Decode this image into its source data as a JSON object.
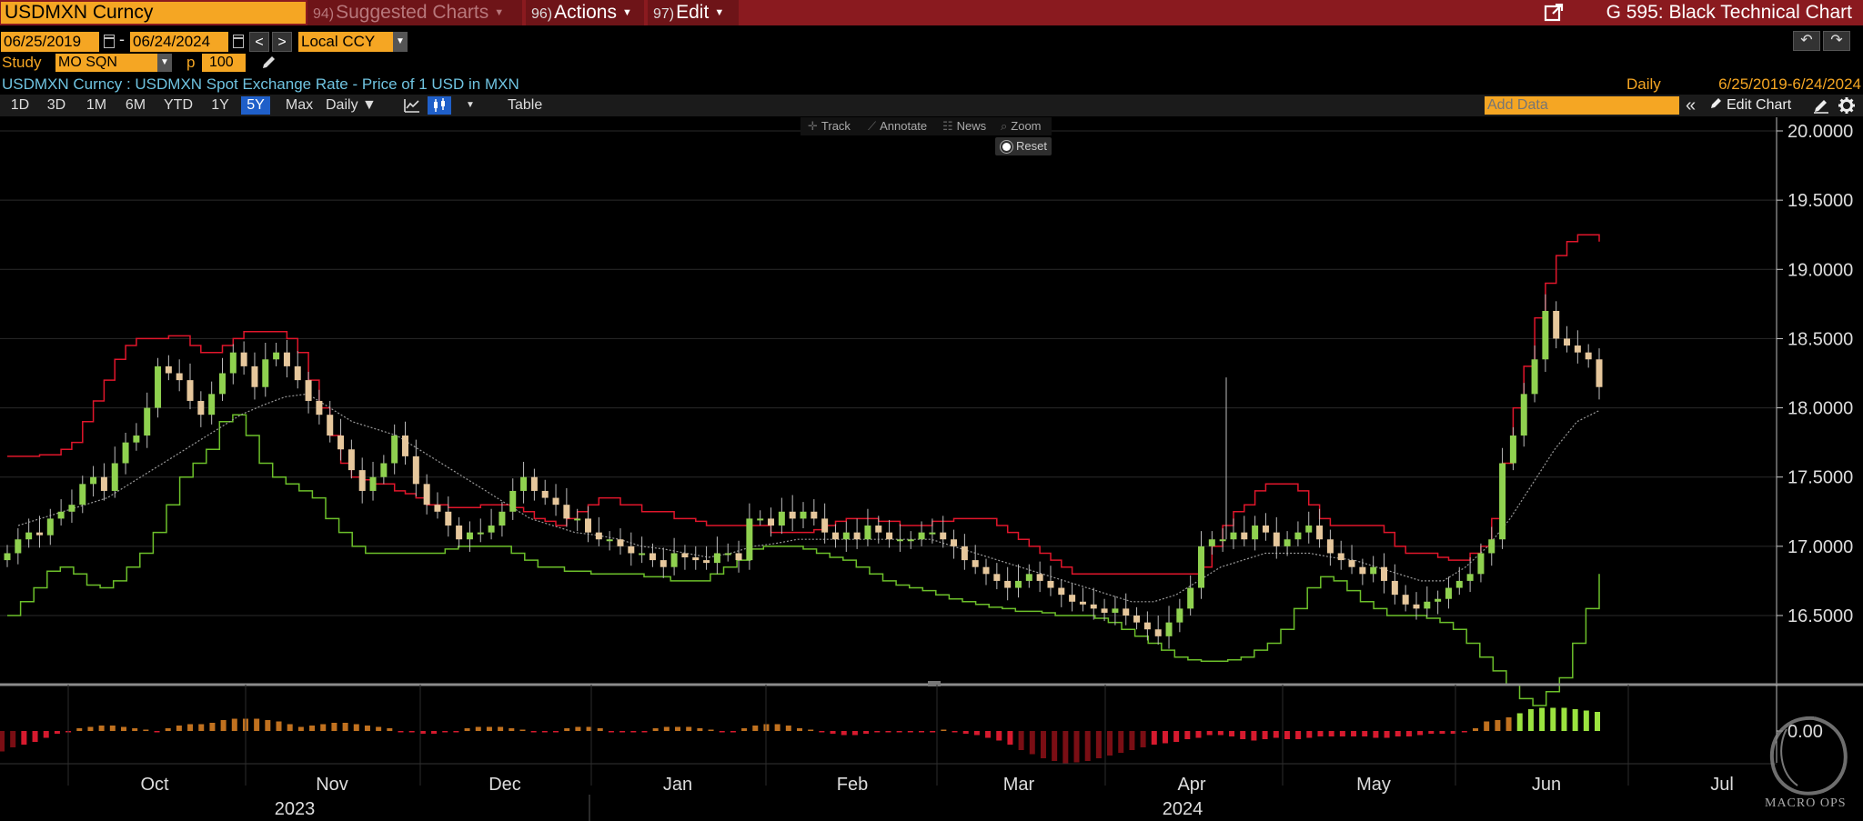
{
  "header": {
    "ticker": "USDMXN Curncy",
    "suggested": {
      "num": "94)",
      "label": "Suggested Charts"
    },
    "actions": {
      "num": "96)",
      "label": "Actions"
    },
    "edit": {
      "num": "97)",
      "label": "Edit"
    },
    "title": "G 595: Black Technical Chart"
  },
  "controls": {
    "start_date": "06/25/2019",
    "end_date": "06/24/2024",
    "date_separator": "-",
    "prev": "<",
    "next": ">",
    "currency": "Local CCY",
    "study_label": "Study",
    "study_value": "MO SQN",
    "p_label": "p",
    "p_value": "100",
    "undo": "↶",
    "redo": "↷"
  },
  "security": {
    "description": "USDMXN Curncy : USDMXN Spot Exchange Rate - Price of 1 USD in MXN",
    "frequency": "Daily",
    "range": "6/25/2019-6/24/2024"
  },
  "toolbar": {
    "ranges": [
      "1D",
      "3D",
      "1M",
      "6M",
      "YTD",
      "1Y",
      "5Y",
      "Max"
    ],
    "active_range": "5Y",
    "frequency": "Daily ▼",
    "more": "▼",
    "table": "Table",
    "add_data_placeholder": "Add Data",
    "collapse": "«",
    "edit_chart": "Edit Chart"
  },
  "chart_tools": {
    "track": "Track",
    "annotate": "Annotate",
    "news": "News",
    "zoom": "Zoom",
    "reset": "Reset"
  },
  "watermark": "MACRO OPS",
  "chart_data": {
    "type": "candlestick",
    "title": "USDMXN Curncy",
    "ylim": [
      16.0,
      20.1
    ],
    "yticks": [
      "20.0000",
      "19.5000",
      "19.0000",
      "18.5000",
      "18.0000",
      "17.5000",
      "17.0000",
      "16.5000"
    ],
    "ytick_values": [
      20.0,
      19.5,
      19.0,
      18.5,
      18.0,
      17.5,
      17.0,
      16.5
    ],
    "xticks": [
      "Oct",
      "Nov",
      "Dec",
      "Jan",
      "Feb",
      "Mar",
      "Apr",
      "May",
      "Jun",
      "Jul"
    ],
    "years": [
      "2023",
      "2024"
    ],
    "colors": {
      "up": "#8fd14f",
      "down": "#e6c79c",
      "upper_band": "#e0162b",
      "lower_band": "#6cbf2a",
      "mid": "#9a9a9a",
      "grid": "#2a2a2a"
    },
    "close": [
      16.95,
      17.05,
      17.1,
      17.08,
      17.2,
      17.25,
      17.3,
      17.45,
      17.5,
      17.4,
      17.6,
      17.75,
      17.8,
      18.0,
      18.3,
      18.25,
      18.2,
      18.05,
      17.95,
      18.1,
      18.25,
      18.4,
      18.3,
      18.15,
      18.35,
      18.4,
      18.3,
      18.2,
      18.05,
      17.95,
      17.8,
      17.7,
      17.55,
      17.4,
      17.5,
      17.6,
      17.8,
      17.65,
      17.45,
      17.3,
      17.25,
      17.15,
      17.05,
      17.1,
      17.1,
      17.15,
      17.25,
      17.4,
      17.5,
      17.4,
      17.35,
      17.3,
      17.2,
      17.2,
      17.1,
      17.05,
      17.05,
      17.0,
      16.95,
      16.95,
      16.9,
      16.85,
      16.95,
      16.92,
      16.9,
      16.88,
      16.95,
      16.95,
      16.9,
      17.2,
      17.2,
      17.15,
      17.25,
      17.2,
      17.25,
      17.2,
      17.1,
      17.05,
      17.1,
      17.05,
      17.15,
      17.1,
      17.05,
      17.05,
      17.05,
      17.1,
      17.1,
      17.05,
      17.0,
      16.9,
      16.85,
      16.8,
      16.75,
      16.7,
      16.75,
      16.8,
      16.75,
      16.7,
      16.65,
      16.6,
      16.58,
      16.55,
      16.52,
      16.55,
      16.5,
      16.45,
      16.4,
      16.35,
      16.45,
      16.55,
      16.7,
      17.0,
      17.05,
      17.05,
      17.1,
      17.05,
      17.15,
      17.1,
      17.0,
      17.05,
      17.1,
      17.15,
      17.05,
      16.95,
      16.9,
      16.85,
      16.8,
      16.85,
      16.75,
      16.65,
      16.58,
      16.55,
      16.6,
      16.62,
      16.7,
      16.75,
      16.8,
      16.95,
      17.05,
      17.6,
      17.8,
      18.1,
      18.35,
      18.7,
      18.5,
      18.45,
      18.4,
      18.35,
      18.15
    ],
    "upper_band": [
      17.65,
      17.65,
      17.65,
      17.66,
      17.66,
      17.7,
      17.75,
      17.9,
      18.05,
      18.2,
      18.35,
      18.45,
      18.5,
      18.5,
      18.5,
      18.52,
      18.52,
      18.45,
      18.4,
      18.4,
      18.45,
      18.5,
      18.55,
      18.55,
      18.55,
      18.55,
      18.5,
      18.4,
      18.2,
      18.0,
      17.8,
      17.6,
      17.5,
      17.48,
      17.45,
      17.45,
      17.4,
      17.38,
      17.35,
      17.3,
      17.3,
      17.28,
      17.28,
      17.28,
      17.3,
      17.3,
      17.3,
      17.28,
      17.25,
      17.2,
      17.18,
      17.15,
      17.2,
      17.25,
      17.3,
      17.35,
      17.35,
      17.3,
      17.3,
      17.25,
      17.25,
      17.25,
      17.2,
      17.2,
      17.18,
      17.15,
      17.15,
      17.15,
      17.15,
      17.15,
      17.15,
      17.1,
      17.1,
      17.1,
      17.1,
      17.12,
      17.15,
      17.18,
      17.2,
      17.2,
      17.2,
      17.18,
      17.18,
      17.15,
      17.15,
      17.15,
      17.18,
      17.18,
      17.2,
      17.2,
      17.2,
      17.2,
      17.15,
      17.1,
      17.05,
      17.0,
      16.95,
      16.9,
      16.85,
      16.8,
      16.8,
      16.8,
      16.8,
      16.8,
      16.8,
      16.8,
      16.8,
      16.8,
      16.8,
      16.8,
      16.8,
      16.85,
      17.0,
      17.15,
      17.25,
      17.3,
      17.4,
      17.45,
      17.45,
      17.45,
      17.4,
      17.3,
      17.2,
      17.15,
      17.15,
      17.15,
      17.15,
      17.15,
      17.1,
      17.0,
      16.95,
      16.95,
      16.95,
      16.92,
      16.9,
      16.9,
      16.95,
      17.0,
      17.2,
      17.6,
      18.0,
      18.3,
      18.65,
      18.9,
      19.1,
      19.2,
      19.25,
      19.25,
      19.2
    ],
    "lower_band": [
      16.5,
      16.6,
      16.7,
      16.82,
      16.85,
      16.8,
      16.72,
      16.7,
      16.75,
      16.85,
      16.95,
      17.1,
      17.3,
      17.5,
      17.6,
      17.7,
      17.9,
      17.95,
      17.8,
      17.6,
      17.5,
      17.45,
      17.4,
      17.35,
      17.2,
      17.1,
      17.0,
      16.95,
      16.95,
      16.95,
      16.95,
      16.95,
      16.95,
      16.98,
      17.0,
      17.0,
      17.0,
      17.0,
      16.95,
      16.9,
      16.85,
      16.85,
      16.82,
      16.82,
      16.8,
      16.8,
      16.8,
      16.8,
      16.78,
      16.78,
      16.75,
      16.75,
      16.75,
      16.8,
      16.85,
      16.9,
      16.98,
      17.0,
      17.0,
      17.0,
      16.98,
      16.95,
      16.92,
      16.9,
      16.85,
      16.8,
      16.75,
      16.72,
      16.7,
      16.68,
      16.65,
      16.62,
      16.6,
      16.58,
      16.56,
      16.55,
      16.53,
      16.53,
      16.52,
      16.5,
      16.5,
      16.5,
      16.48,
      16.45,
      16.4,
      16.35,
      16.3,
      16.25,
      16.2,
      16.18,
      16.17,
      16.17,
      16.18,
      16.2,
      16.25,
      16.3,
      16.4,
      16.55,
      16.7,
      16.78,
      16.75,
      16.68,
      16.6,
      16.55,
      16.5,
      16.5,
      16.5,
      16.48,
      16.45,
      16.4,
      16.3,
      16.2,
      16.1,
      16.0,
      15.9,
      15.85,
      15.95,
      16.05,
      16.3,
      16.55,
      16.8
    ],
    "mid_line": [
      17.15,
      17.2,
      17.25,
      17.3,
      17.35,
      17.45,
      17.55,
      17.65,
      17.75,
      17.85,
      17.95,
      18.02,
      18.08,
      18.1,
      18.0,
      17.9,
      17.85,
      17.8,
      17.7,
      17.6,
      17.5,
      17.4,
      17.3,
      17.2,
      17.15,
      17.1,
      17.08,
      17.05,
      17.0,
      16.98,
      16.95,
      16.92,
      16.95,
      17.0,
      17.02,
      17.05,
      17.05,
      17.05,
      17.05,
      17.05,
      17.05,
      17.05,
      17.0,
      16.95,
      16.9,
      16.85,
      16.8,
      16.75,
      16.7,
      16.65,
      16.6,
      16.6,
      16.65,
      16.75,
      16.85,
      16.9,
      16.95,
      16.95,
      16.95,
      16.92,
      16.9,
      16.85,
      16.8,
      16.75,
      16.75,
      16.85,
      17.0,
      17.2,
      17.45,
      17.7,
      17.9,
      17.98
    ],
    "momentum": [
      -0.15,
      -0.12,
      -0.1,
      -0.08,
      -0.05,
      -0.02,
      0.0,
      0.02,
      0.03,
      0.04,
      0.04,
      0.03,
      0.02,
      0.01,
      0.0,
      0.02,
      0.04,
      0.05,
      0.05,
      0.06,
      0.08,
      0.09,
      0.09,
      0.09,
      0.08,
      0.07,
      0.05,
      0.03,
      0.04,
      0.05,
      0.06,
      0.06,
      0.05,
      0.04,
      0.03,
      0.02,
      0.0,
      -0.01,
      -0.02,
      -0.02,
      -0.01,
      0.0,
      0.02,
      0.03,
      0.03,
      0.03,
      0.02,
      0.01,
      0.0,
      -0.01,
      0.0,
      0.02,
      0.03,
      0.03,
      0.02,
      0.0,
      -0.01,
      -0.01,
      0.0,
      0.02,
      0.03,
      0.03,
      0.03,
      0.02,
      0.01,
      0.0,
      0.0,
      0.02,
      0.04,
      0.05,
      0.05,
      0.04,
      0.02,
      0.01,
      0.0,
      -0.02,
      -0.03,
      -0.03,
      -0.02,
      -0.01,
      0.0,
      -0.01,
      -0.01,
      0.0,
      0.0,
      0.01,
      -0.01,
      -0.02,
      -0.03,
      -0.05,
      -0.07,
      -0.1,
      -0.14,
      -0.17,
      -0.2,
      -0.22,
      -0.24,
      -0.23,
      -0.22,
      -0.2,
      -0.18,
      -0.16,
      -0.14,
      -0.12,
      -0.1,
      -0.09,
      -0.08,
      -0.06,
      -0.05,
      -0.03,
      -0.03,
      -0.04,
      -0.06,
      -0.07,
      -0.06,
      -0.05,
      -0.06,
      -0.06,
      -0.05,
      -0.04,
      -0.04,
      -0.04,
      -0.04,
      -0.04,
      -0.05,
      -0.05,
      -0.04,
      -0.04,
      -0.03,
      -0.02,
      -0.02,
      -0.02,
      -0.01,
      0.02,
      0.07,
      0.08,
      0.1,
      0.13,
      0.16,
      0.17,
      0.17,
      0.17,
      0.16,
      0.15,
      0.14
    ],
    "momentum_zero_label": "0.00"
  }
}
